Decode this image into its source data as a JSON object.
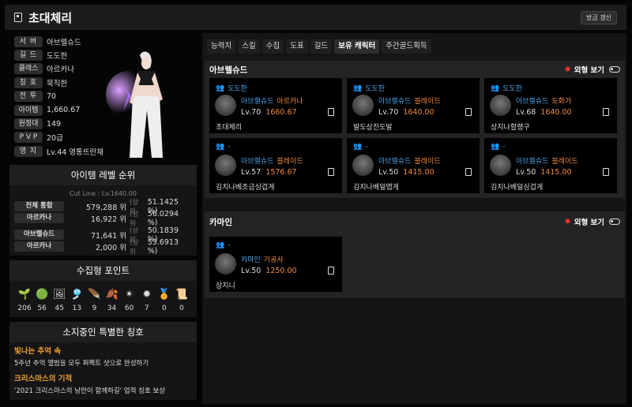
{
  "header": {
    "title": "초대체리",
    "refresh_label": "방금 갱신"
  },
  "profile": {
    "rows": [
      {
        "key": "서 버",
        "value": "아브렐슈드"
      },
      {
        "key": "길 드",
        "value": "도도한"
      },
      {
        "key": "클래스",
        "value": "아르카나"
      },
      {
        "key": "칭 호",
        "value": "묵직한"
      },
      {
        "key": "전 투",
        "value": "70"
      },
      {
        "key": "아이템",
        "value": "1,660.67"
      },
      {
        "key": "원정대",
        "value": "149"
      },
      {
        "key": "P V P",
        "value": "20급"
      },
      {
        "key": "영 지",
        "value": "Lv.44 영통뜨란채"
      }
    ]
  },
  "ranking": {
    "title": "아이템 레벨 순위",
    "cutline": "Cut Line : Lv.1640.00",
    "rows": [
      {
        "tag": "전체 통합",
        "num": "579,288 위",
        "unit": "(상위",
        "pct": "51.1425 %)"
      },
      {
        "tag": "아르카나",
        "num": "16,922 위",
        "unit": "(상위",
        "pct": "56.0294 %)"
      },
      {
        "tag": "아브렐슈드",
        "num": "71,641 위",
        "unit": "(상위",
        "pct": "50.1839 %)"
      },
      {
        "tag": "아르카나",
        "num": "2,000 위",
        "unit": "(상위",
        "pct": "53.6913 %)"
      }
    ]
  },
  "collect": {
    "title": "수집형 포인트",
    "items": [
      {
        "icon": "seed-icon",
        "glyph": "🌱",
        "count": "206"
      },
      {
        "icon": "island-heart-icon",
        "glyph": "🟢",
        "count": "56"
      },
      {
        "icon": "art-icon",
        "glyph": "🖼",
        "count": "45"
      },
      {
        "icon": "token-icon",
        "glyph": "🎐",
        "count": "13"
      },
      {
        "icon": "mokoko-icon",
        "glyph": "🪶",
        "count": "9"
      },
      {
        "icon": "world-tree-leaf-icon",
        "glyph": "🍂",
        "count": "34"
      },
      {
        "icon": "star-icon",
        "glyph": "✴",
        "count": "60"
      },
      {
        "icon": "orpheus-star-icon",
        "glyph": "✹",
        "count": "7"
      },
      {
        "icon": "medal-icon",
        "glyph": "🏅",
        "count": "0"
      },
      {
        "icon": "chart-icon",
        "glyph": "📜",
        "count": "0"
      }
    ]
  },
  "special_titles": {
    "title": "소지중인 특별한 칭호",
    "items": [
      {
        "name": "빛나는 추억 속",
        "desc": "5주년 추억 앨범을 모두 퍼펙트 샷으로 완성하기"
      },
      {
        "name": "크리스마스의 기적",
        "desc": "'2021 크리스마스의 낭만이 함께하길' 업적 칭호 보상"
      }
    ]
  },
  "tabs": [
    "능력치",
    "스킬",
    "수집",
    "도표",
    "길드",
    "보유 캐릭터",
    "주간골드획득"
  ],
  "active_tab": "보유 캐릭터",
  "sections": [
    {
      "server": "아브렐슈드",
      "toggle_label": "외형 보기",
      "cards": [
        {
          "guild": "도도한",
          "server": "아브렐슈드",
          "cls": "아르카나",
          "lv": "Lv.70",
          "ilvl": "1660.67",
          "name": "초대체리"
        },
        {
          "guild": "도도한",
          "server": "아브렐슈드",
          "cls": "블레이드",
          "lv": "Lv.70",
          "ilvl": "1640.00",
          "name": "발도상진도발"
        },
        {
          "guild": "도도한",
          "server": "아브렐슈드",
          "cls": "도화가",
          "lv": "Lv.68",
          "ilvl": "1640.00",
          "name": "상지나할랭구"
        },
        {
          "guild": "-",
          "server": "아브렐슈드",
          "cls": "블레이드",
          "lv": "Lv.57",
          "ilvl": "1576.67",
          "name": "김치나베조금싱겁게"
        },
        {
          "guild": "-",
          "server": "아브렐슈드",
          "cls": "블레이드",
          "lv": "Lv.50",
          "ilvl": "1415.00",
          "name": "김치나베덜맵게"
        },
        {
          "guild": "-",
          "server": "아브렐슈드",
          "cls": "블레이드",
          "lv": "Lv.50",
          "ilvl": "1415.00",
          "name": "김치나베덜싱겁게"
        }
      ]
    },
    {
      "server": "카마인",
      "toggle_label": "외형 보기",
      "cards": [
        {
          "guild": "-",
          "server": "카마인",
          "cls": "기공사",
          "lv": "Lv.50",
          "ilvl": "1250.00",
          "name": "상지니"
        }
      ]
    }
  ],
  "colors": {
    "accent_blue": "#4aa3e8",
    "accent_orange": "#f08a3a",
    "title_gold": "#f0a030",
    "toggle_red": "#ff3030"
  }
}
